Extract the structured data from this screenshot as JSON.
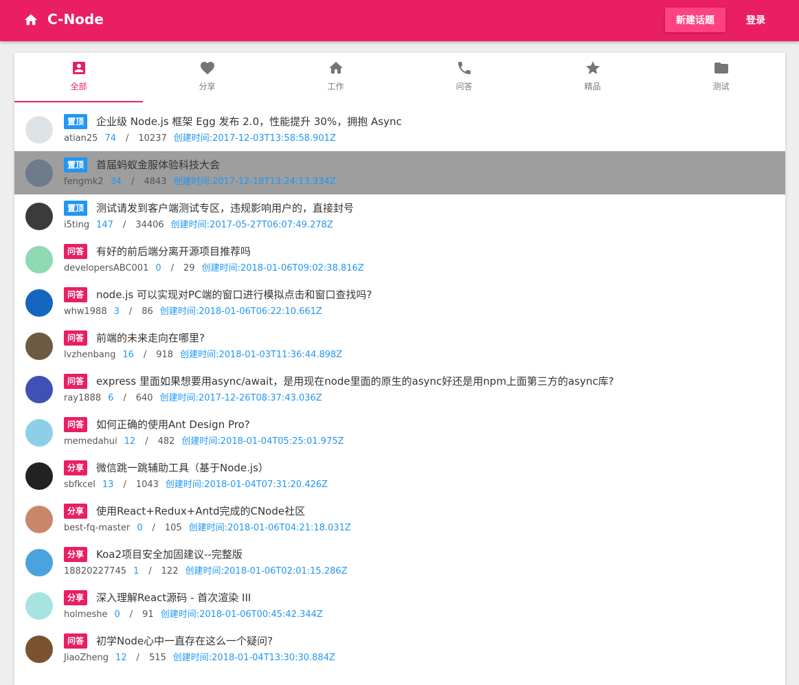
{
  "header": {
    "title": "C-Node",
    "new_topic_label": "新建话题",
    "login_label": "登录",
    "bg_color": "#e91e63"
  },
  "tabs": [
    {
      "label": "全部",
      "icon": "account-box-icon",
      "active": true
    },
    {
      "label": "分享",
      "icon": "heart-icon",
      "active": false
    },
    {
      "label": "工作",
      "icon": "home-icon",
      "active": false
    },
    {
      "label": "问答",
      "icon": "phone-icon",
      "active": false
    },
    {
      "label": "精品",
      "icon": "star-icon",
      "active": false
    },
    {
      "label": "测试",
      "icon": "folder-icon",
      "active": false
    }
  ],
  "created_prefix": "创建时间:",
  "topics": [
    {
      "badge": "置顶",
      "badge_type": "top",
      "title": "企业级 Node.js 框架 Egg 发布 2.0，性能提升 30%，拥抱 Async",
      "author": "atian25",
      "replies": "74",
      "visits": "10237",
      "created": "2017-12-03T13:58:58.901Z",
      "avatar_color": "#dde3e6"
    },
    {
      "badge": "置顶",
      "badge_type": "top",
      "title": "首届蚂蚁金服体验科技大会",
      "author": "fengmk2",
      "replies": "34",
      "visits": "4843",
      "created": "2017-12-18T13:24:13.334Z",
      "avatar_color": "#6d7b8a",
      "highlight": true
    },
    {
      "badge": "置顶",
      "badge_type": "top",
      "title": "测试请发到客户端测试专区，违规影响用户的，直接封号",
      "author": "i5ting",
      "replies": "147",
      "visits": "34406",
      "created": "2017-05-27T06:07:49.278Z",
      "avatar_color": "#3b3b3b"
    },
    {
      "badge": "问答",
      "badge_type": "ask",
      "title": "有好的前后端分离开源项目推荐吗",
      "author": "developersABC001",
      "replies": "0",
      "visits": "29",
      "created": "2018-01-06T09:02:38.816Z",
      "avatar_color": "#8fd9b3"
    },
    {
      "badge": "问答",
      "badge_type": "ask",
      "title": "node.js 可以实现对PC端的窗口进行模拟点击和窗口查找吗?",
      "author": "whw1988",
      "replies": "3",
      "visits": "86",
      "created": "2018-01-06T06:22:10.661Z",
      "avatar_color": "#1565c0"
    },
    {
      "badge": "问答",
      "badge_type": "ask",
      "title": "前端的未来走向在哪里?",
      "author": "lvzhenbang",
      "replies": "16",
      "visits": "918",
      "created": "2018-01-03T11:36:44.898Z",
      "avatar_color": "#6d5a42"
    },
    {
      "badge": "问答",
      "badge_type": "ask",
      "title": "express 里面如果想要用async/await，是用现在node里面的原生的async好还是用npm上面第三方的async库?",
      "author": "ray1888",
      "replies": "6",
      "visits": "640",
      "created": "2017-12-26T08:37:43.036Z",
      "avatar_color": "#3f51b5"
    },
    {
      "badge": "问答",
      "badge_type": "ask",
      "title": "如何正确的使用Ant Design Pro?",
      "author": "memedahui",
      "replies": "12",
      "visits": "482",
      "created": "2018-01-04T05:25:01.975Z",
      "avatar_color": "#8ecfe8"
    },
    {
      "badge": "分享",
      "badge_type": "share",
      "title": "微信跳一跳辅助工具（基于Node.js）",
      "author": "sbfkcel",
      "replies": "13",
      "visits": "1043",
      "created": "2018-01-04T07:31:20.426Z",
      "avatar_color": "#222222"
    },
    {
      "badge": "分享",
      "badge_type": "share",
      "title": "使用React+Redux+Antd完成的CNode社区",
      "author": "best-fq-master",
      "replies": "0",
      "visits": "105",
      "created": "2018-01-06T04:21:18.031Z",
      "avatar_color": "#c9876a"
    },
    {
      "badge": "分享",
      "badge_type": "share",
      "title": "Koa2项目安全加固建议--完整版",
      "author": "18820227745",
      "replies": "1",
      "visits": "122",
      "created": "2018-01-06T02:01:15.286Z",
      "avatar_color": "#4aa3df"
    },
    {
      "badge": "分享",
      "badge_type": "share",
      "title": "深入理解React源码 - 首次渲染 III",
      "author": "holmeshe",
      "replies": "0",
      "visits": "91",
      "created": "2018-01-06T00:45:42.344Z",
      "avatar_color": "#a7e3e0"
    },
    {
      "badge": "问答",
      "badge_type": "ask",
      "title": "初学Node心中一直存在这么一个疑问?",
      "author": "JiaoZheng",
      "replies": "12",
      "visits": "515",
      "created": "2018-01-04T13:30:30.884Z",
      "avatar_color": "#7a5230"
    }
  ]
}
